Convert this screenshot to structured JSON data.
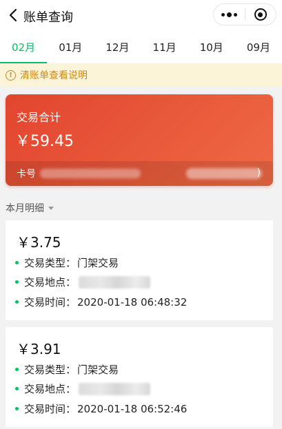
{
  "header": {
    "title": "账单查询",
    "back_icon": "chevron-left-icon",
    "more_icon": "more-dots-icon",
    "close_icon": "target-circle-icon"
  },
  "tabs": [
    {
      "label": "02月",
      "active": true
    },
    {
      "label": "01月",
      "active": false
    },
    {
      "label": "12月",
      "active": false
    },
    {
      "label": "11月",
      "active": false
    },
    {
      "label": "10月",
      "active": false
    },
    {
      "label": "09月",
      "active": false
    }
  ],
  "notice": {
    "icon": "!",
    "text": "清账单查看说明"
  },
  "summary": {
    "label": "交易合计",
    "amount": "￥59.45",
    "card_label": "卡号",
    "card_suffix": ")"
  },
  "section": {
    "title": "本月明细"
  },
  "transactions": [
    {
      "amount": "￥3.75",
      "type_label": "交易类型：",
      "type_value": "门架交易",
      "place_label": "交易地点：",
      "time_label": "交易时间：",
      "time_value": "2020-01-18 06:48:32"
    },
    {
      "amount": "￥3.91",
      "type_label": "交易类型：",
      "type_value": "门架交易",
      "place_label": "交易地点：",
      "time_label": "交易时间：",
      "time_value": "2020-01-18 06:52:46"
    }
  ],
  "colors": {
    "accent": "#07c160",
    "card_start": "#e2452f",
    "card_end": "#ee6a45",
    "notice_bg": "#fbf4d9",
    "notice_text": "#c98a1e"
  }
}
